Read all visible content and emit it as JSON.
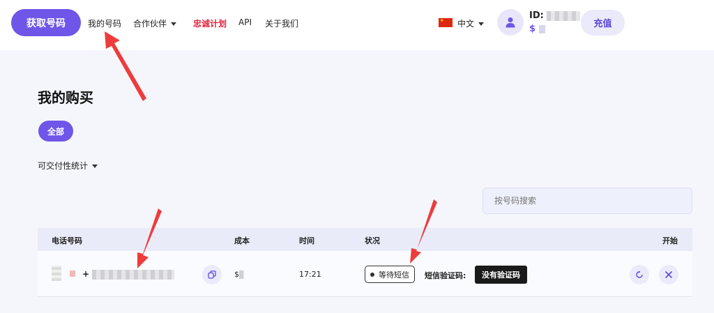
{
  "header": {
    "cta_label": "获取号码",
    "nav": [
      {
        "label": "我的号码"
      },
      {
        "label": "合作伙伴"
      },
      {
        "label": "忠诚计划"
      },
      {
        "label": "API"
      },
      {
        "label": "关于我们"
      }
    ],
    "language": "中文",
    "user_id_label": "ID:",
    "balance_symbol": "$",
    "recharge_label": "充值"
  },
  "main": {
    "title": "我的购买",
    "filter_all": "全部",
    "stats_label": "可交付性统计",
    "search_placeholder": "按号码搜索",
    "table": {
      "columns": [
        "电话号码",
        "成本",
        "时间",
        "状况",
        "开始"
      ],
      "rows": [
        {
          "phone_prefix": "+",
          "cost_symbol": "$",
          "time": "17:21",
          "status": "等待短信",
          "sms_label": "短信验证码:",
          "sms_value": "没有验证码"
        }
      ]
    }
  },
  "colors": {
    "primary": "#6f56e8",
    "active_nav": "#e0203a",
    "arrow": "#ee3b3b"
  }
}
